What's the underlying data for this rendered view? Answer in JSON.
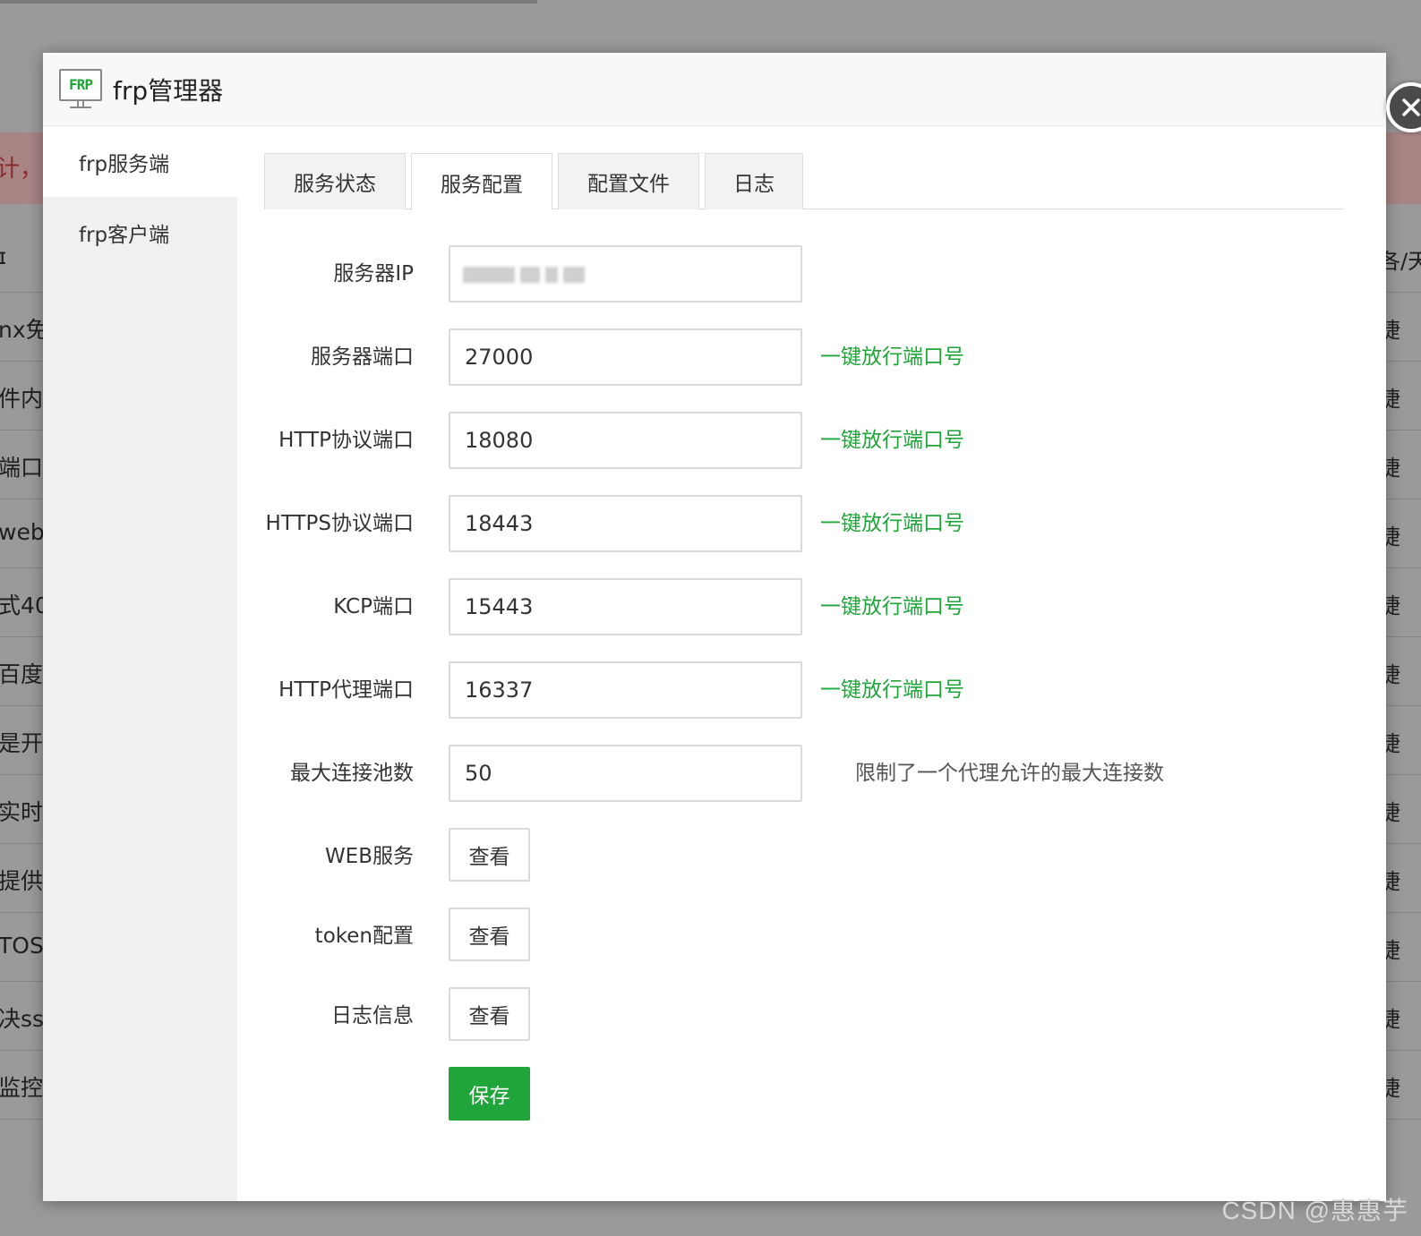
{
  "background": {
    "warn_text": "计，但",
    "rows": [
      {
        "left": "ɪ",
        "right": "各/天"
      },
      {
        "left": "nx免",
        "right": "捷"
      },
      {
        "left": "件内容",
        "right": "捷"
      },
      {
        "left": "端口",
        "right": "捷"
      },
      {
        "left": "web",
        "right": "捷"
      },
      {
        "left": "式40",
        "right": "捷"
      },
      {
        "left": "百度",
        "right": "捷"
      },
      {
        "left": "是开",
        "right": "捷"
      },
      {
        "left": "实时",
        "right": "捷"
      },
      {
        "left": "提供",
        "right": "捷"
      },
      {
        "left": "TOSI",
        "right": "捷"
      },
      {
        "left": "决ss",
        "right": "捷"
      },
      {
        "left": "监控",
        "right": "捷"
      }
    ]
  },
  "modal": {
    "logo_text": "FRP",
    "title": "frp管理器",
    "sidebar": [
      {
        "label": "frp服务端",
        "active": true
      },
      {
        "label": "frp客户端",
        "active": false
      }
    ],
    "tabs": [
      {
        "label": "服务状态",
        "active": false
      },
      {
        "label": "服务配置",
        "active": true
      },
      {
        "label": "配置文件",
        "active": false
      },
      {
        "label": "日志",
        "active": false
      }
    ],
    "form": {
      "server_ip": {
        "label": "服务器IP",
        "value": ""
      },
      "server_port": {
        "label": "服务器端口",
        "value": "27000",
        "hint": "一键放行端口号"
      },
      "http_port": {
        "label": "HTTP协议端口",
        "value": "18080",
        "hint": "一键放行端口号"
      },
      "https_port": {
        "label": "HTTPS协议端口",
        "value": "18443",
        "hint": "一键放行端口号"
      },
      "kcp_port": {
        "label": "KCP端口",
        "value": "15443",
        "hint": "一键放行端口号"
      },
      "http_proxy_port": {
        "label": "HTTP代理端口",
        "value": "16337",
        "hint": "一键放行端口号"
      },
      "max_pool": {
        "label": "最大连接池数",
        "value": "50",
        "hint": "限制了一个代理允许的最大连接数"
      },
      "web_service": {
        "label": "WEB服务",
        "button": "查看"
      },
      "token_config": {
        "label": "token配置",
        "button": "查看"
      },
      "log_info": {
        "label": "日志信息",
        "button": "查看"
      },
      "save_label": "保存"
    }
  },
  "watermark": "CSDN @惠惠芋",
  "colors": {
    "accent": "#20a53a",
    "overlay": "#9a9a9a"
  }
}
